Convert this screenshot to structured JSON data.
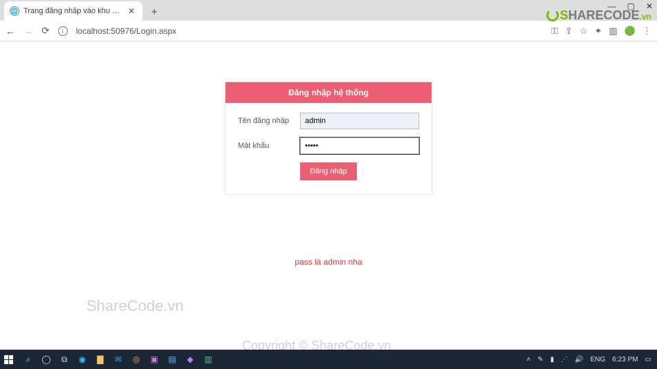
{
  "browser": {
    "tab_title": "Trang đăng nhập vào khu vực qu",
    "url": "localhost:50976/Login.aspx"
  },
  "login": {
    "header": "Đăng nhập hệ thống",
    "username_label": "Tên đăng nhập",
    "username_value": "admin",
    "password_label": "Mật khẩu",
    "password_value": "•••••",
    "submit_label": "Đăng nhập"
  },
  "hint_text": "pass là admin nha",
  "watermarks": {
    "wm1": "ShareCode.vn",
    "wm2": "Copyright © ShareCode.vn",
    "logo_main": "SHARECODE",
    "logo_suffix": ".vn"
  },
  "taskbar": {
    "lang": "ENG",
    "time": "6:23 PM"
  }
}
